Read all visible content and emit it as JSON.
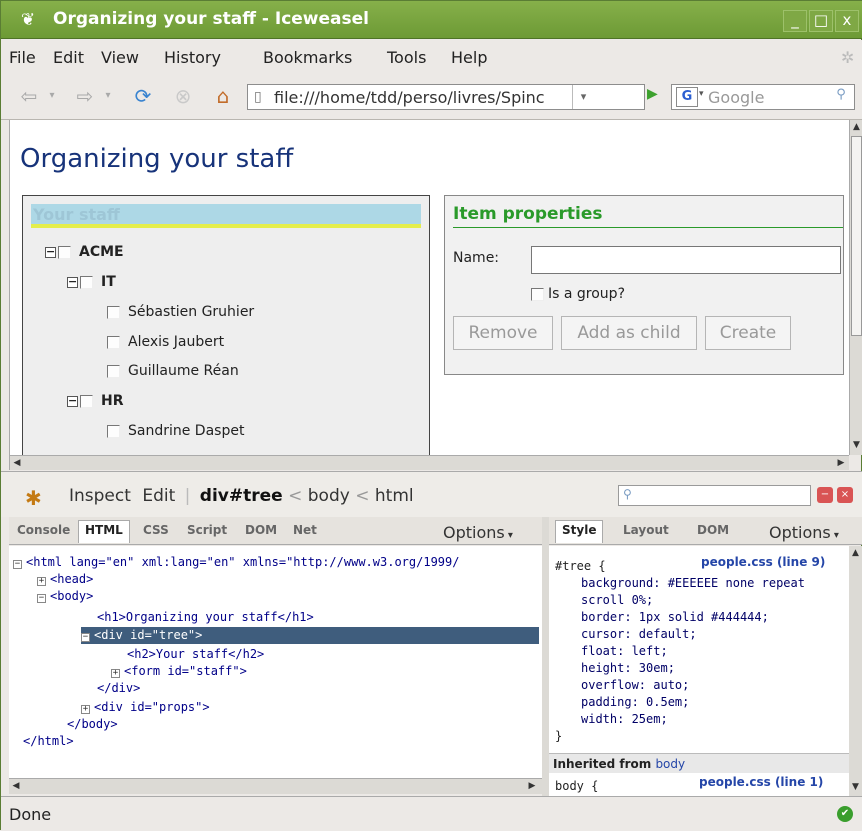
{
  "window": {
    "title": "Organizing your staff - Iceweasel",
    "minimize": "_",
    "maximize": "□",
    "close": "x"
  },
  "menu": [
    "File",
    "Edit",
    "View",
    "History",
    "Bookmarks",
    "Tools",
    "Help"
  ],
  "nav": {
    "url": "file:///home/tdd/perso/livres/Spinc",
    "search_placeholder": "Google",
    "search_engine": "G"
  },
  "page": {
    "heading": "Organizing your staff",
    "tree": {
      "title": "Your staff",
      "items": [
        {
          "label": "ACME",
          "bold": true,
          "level": 0,
          "expander": "−"
        },
        {
          "label": "IT",
          "bold": true,
          "level": 1,
          "expander": "−"
        },
        {
          "label": "Sébastien Gruhier",
          "bold": false,
          "level": 2
        },
        {
          "label": "Alexis Jaubert",
          "bold": false,
          "level": 2
        },
        {
          "label": "Guillaume Réan",
          "bold": false,
          "level": 2
        },
        {
          "label": "HR",
          "bold": true,
          "level": 1,
          "expander": "−"
        },
        {
          "label": "Sandrine Daspet",
          "bold": false,
          "level": 2
        }
      ]
    },
    "props": {
      "title": "Item properties",
      "name_label": "Name:",
      "name_value": "",
      "is_group_label": "Is a group?",
      "buttons": [
        "Remove",
        "Add as child",
        "Create"
      ]
    }
  },
  "firebug": {
    "inspect": "Inspect",
    "edit": "Edit",
    "breadcrumb_current": "div#tree",
    "breadcrumb_sep": "<",
    "breadcrumb_1": "body",
    "breadcrumb_2": "html",
    "tabs_left": [
      "Console",
      "HTML",
      "CSS",
      "Script",
      "DOM",
      "Net"
    ],
    "tabs_left_selected": "HTML",
    "options": "Options",
    "tabs_right": [
      "Style",
      "Layout",
      "DOM"
    ],
    "tabs_right_selected": "Style",
    "html_lines": [
      "<html lang=\"en\" xml:lang=\"en\" xmlns=\"http://www.w3.org/1999/",
      "<head>",
      "<body>",
      "<h1>Organizing your staff</h1>",
      "<div id=\"tree\">",
      "<h2>Your staff</h2>",
      "<form id=\"staff\">",
      "</div>",
      "<div id=\"props\">",
      "</body>",
      "</html>"
    ],
    "style_selector": "#tree {",
    "style_source": "people.css (line 9)",
    "style_rules": [
      "background: #EEEEEE none repeat",
      "scroll 0%;",
      "border: 1px solid #444444;",
      "cursor: default;",
      "float: left;",
      "height: 30em;",
      "overflow: auto;",
      "padding: 0.5em;",
      "width: 25em;"
    ],
    "style_close": "}",
    "inherited_label": "Inherited from",
    "inherited_from": "body",
    "body_selector": "body {",
    "body_source": "people.css (line 1)"
  },
  "status": {
    "text": "Done"
  },
  "colors": {
    "titlebar": "#7aa53f",
    "heading": "#17337a",
    "selected_row": "#3f5d7d",
    "props_title": "#2a9a2a"
  }
}
